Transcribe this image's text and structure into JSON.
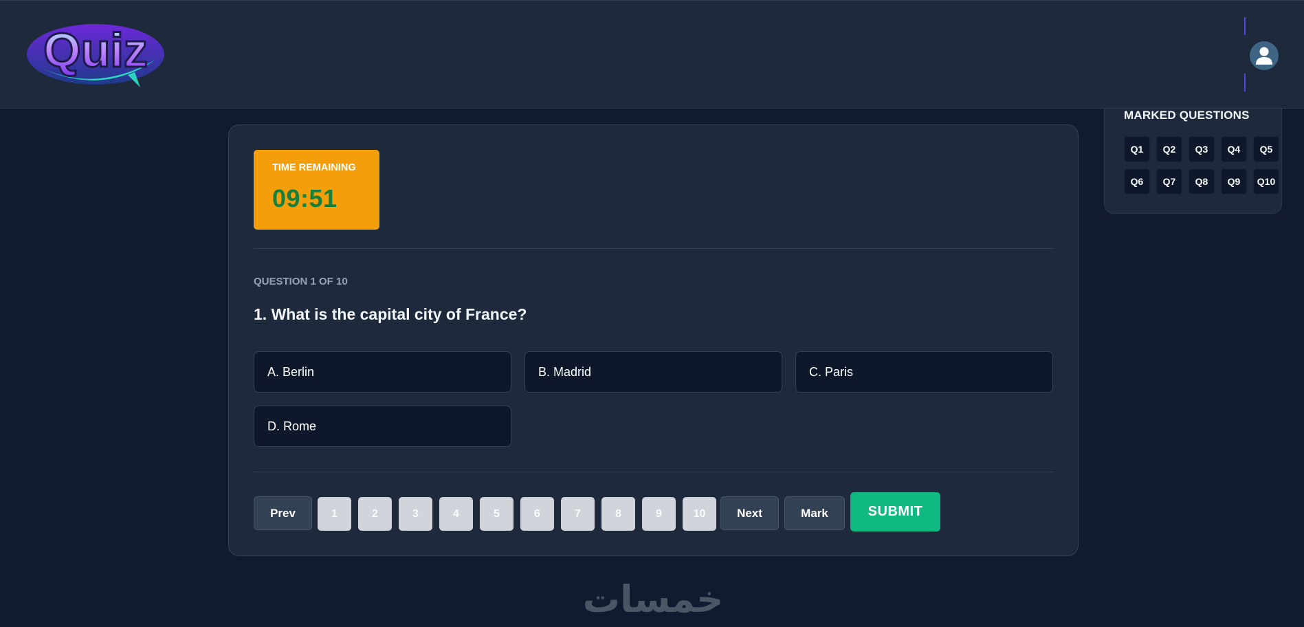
{
  "header": {
    "logo_text": "Quiz"
  },
  "marked_panel": {
    "title": "MARKED QUESTIONS",
    "items": [
      "Q1",
      "Q2",
      "Q3",
      "Q4",
      "Q5",
      "Q6",
      "Q7",
      "Q8",
      "Q9",
      "Q10"
    ]
  },
  "timer": {
    "label": "TIME REMAINING",
    "value": "09:51"
  },
  "question": {
    "progress": "QUESTION 1 OF 10",
    "text": "1. What is the capital city of France?"
  },
  "options": [
    "A. Berlin",
    "B. Madrid",
    "C. Paris",
    "D. Rome"
  ],
  "navigation": {
    "prev_label": "Prev",
    "pages": [
      "1",
      "2",
      "3",
      "4",
      "5",
      "6",
      "7",
      "8",
      "9",
      "10"
    ],
    "next_label": "Next",
    "mark_label": "Mark",
    "submit_label": "SUBMIT"
  },
  "watermark": "خمسات",
  "colors": {
    "background": "#111a2e",
    "panel": "#1e293b",
    "timer": "#f59e0b",
    "timer_text": "#15803d",
    "submit": "#10b981",
    "accent": "#4f46e5"
  }
}
